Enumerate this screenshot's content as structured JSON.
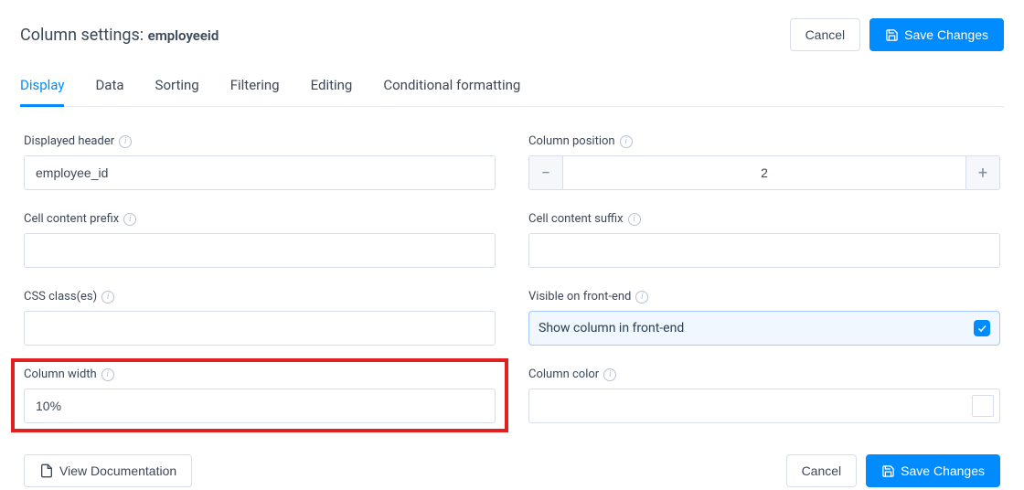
{
  "header": {
    "title_prefix": "Column settings: ",
    "subject": "employeeid",
    "cancel_label": "Cancel",
    "save_label": "Save Changes"
  },
  "tabs": {
    "display": "Display",
    "data": "Data",
    "sorting": "Sorting",
    "filtering": "Filtering",
    "editing": "Editing",
    "conditional": "Conditional formatting"
  },
  "fields": {
    "displayed_header": {
      "label": "Displayed header",
      "value": "employee_id"
    },
    "column_position": {
      "label": "Column position",
      "value": "2"
    },
    "cell_prefix": {
      "label": "Cell content prefix",
      "value": ""
    },
    "cell_suffix": {
      "label": "Cell content suffix",
      "value": ""
    },
    "css_classes": {
      "label": "CSS class(es)",
      "value": ""
    },
    "visible": {
      "label": "Visible on front-end",
      "text": "Show column in front-end",
      "checked": true
    },
    "column_width": {
      "label": "Column width",
      "value": "10%"
    },
    "column_color": {
      "label": "Column color",
      "value": ""
    }
  },
  "footer": {
    "view_docs": "View Documentation",
    "cancel_label": "Cancel",
    "save_label": "Save Changes"
  },
  "info_glyph": "i"
}
